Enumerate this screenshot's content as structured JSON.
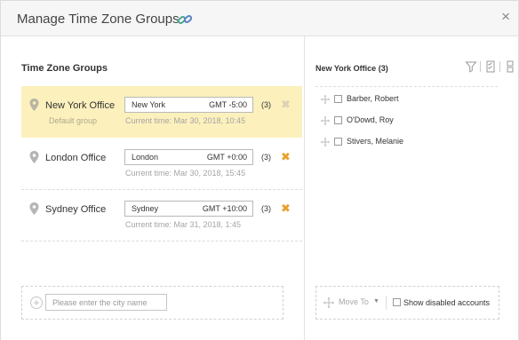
{
  "dialog": {
    "title": "Manage Time Zone Groups",
    "title_icon": "link-icon",
    "close_label": "×"
  },
  "groups_panel": {
    "title": "Time Zone Groups",
    "groups": [
      {
        "name": "New York Office",
        "default_label": "Default group",
        "city": "New York",
        "gmt": "GMT -5:00",
        "current_time": "Current time: Mar 30, 2018, 10:45",
        "count": "(3)",
        "selected": true
      },
      {
        "name": "London Office",
        "city": "London",
        "gmt": "GMT +0:00",
        "current_time": "Current time: Mar 30, 2018, 15:45",
        "count": "(3)",
        "selected": false
      },
      {
        "name": "Sydney Office",
        "city": "Sydney",
        "gmt": "GMT +10:00",
        "current_time": "Current time: Mar 31, 2018, 1:45",
        "count": "(3)",
        "selected": false
      }
    ],
    "add_city_placeholder": "Please enter the city name"
  },
  "accounts_panel": {
    "title": "New York Office (3)",
    "tools": [
      "filter-icon",
      "checklist-icon",
      "columns-icon"
    ],
    "accounts": [
      "Barber, Robert",
      "O'Dowd, Roy",
      "Stivers, Melanie"
    ],
    "move_to_label": "Move To",
    "show_disabled_label": "Show disabled accounts"
  },
  "colors": {
    "selected_row_bg": "#fcf0bd",
    "remove_icon": "#e9a02a",
    "link_icon": "#4aa58f"
  }
}
